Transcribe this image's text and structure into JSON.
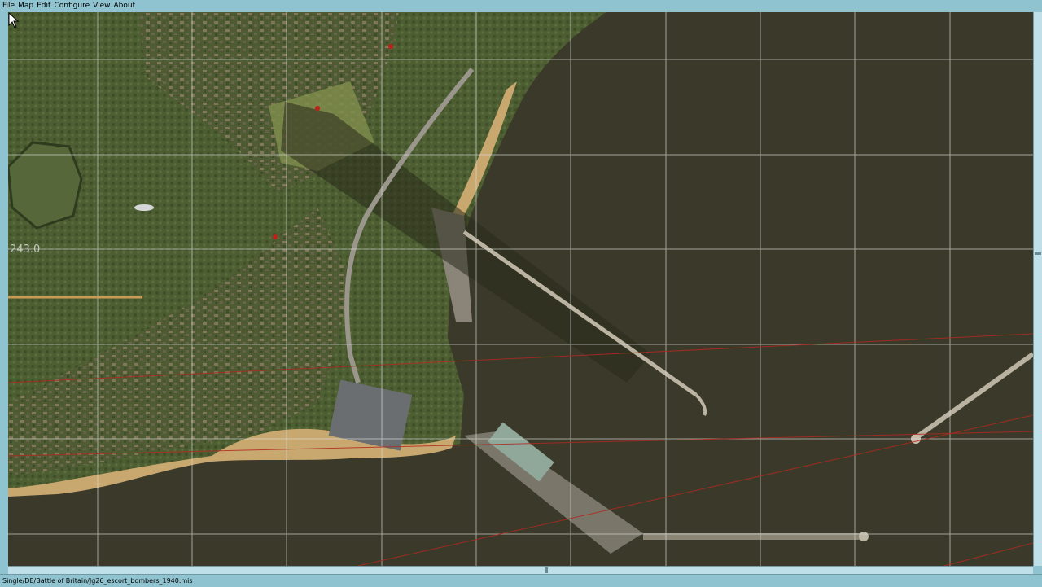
{
  "menu": {
    "items": [
      {
        "label": "File"
      },
      {
        "label": "Map"
      },
      {
        "label": "Edit"
      },
      {
        "label": "Configure"
      },
      {
        "label": "View"
      },
      {
        "label": "About"
      }
    ]
  },
  "map": {
    "coordinate_label": "243.0"
  },
  "status": {
    "mission_path": "Single/DE/Battle of Britain/Jg26_escort_bombers_1940.mis"
  },
  "colors": {
    "background": "#8fc3cf",
    "sea": "#3b3a2a",
    "land": "#5f6e3c",
    "grid": "#d8dcd8",
    "route": "#b02a20"
  }
}
